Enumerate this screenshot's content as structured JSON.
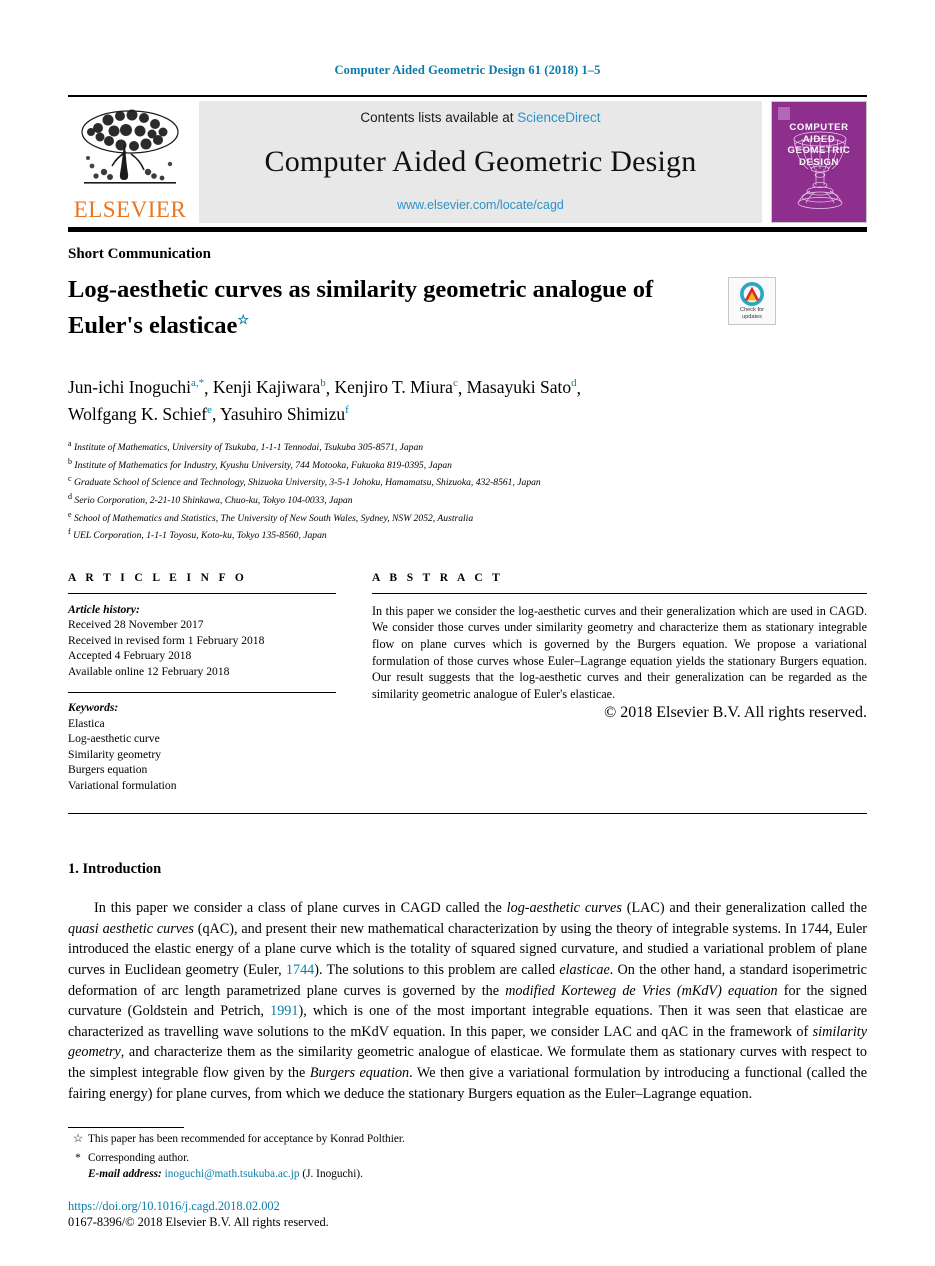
{
  "running_head": "Computer Aided Geometric Design 61 (2018) 1–5",
  "masthead": {
    "publisher_name": "ELSEVIER",
    "contents_prefix": "Contents lists available at",
    "sciencedirect": "ScienceDirect",
    "journal_title": "Computer Aided Geometric Design",
    "journal_url": "www.elsevier.com/locate/cagd",
    "cover_title": "COMPUTER\nAIDED\nGEOMETRIC\nDESIGN",
    "cover_color": "#8e2f8e",
    "link_color": "#2a93c9",
    "elsevier_orange": "#e87722"
  },
  "article": {
    "section_kind": "Short Communication",
    "title_line1": "Log-aesthetic curves as similarity geometric analogue of",
    "title_line2": "Euler's elasticae",
    "title_footnote_mark": "☆",
    "crossmark_label": "Check for\nupdates",
    "authors": [
      {
        "name": "Jun-ichi Inoguchi",
        "sup": "a,*"
      },
      {
        "name": "Kenji Kajiwara",
        "sup": "b"
      },
      {
        "name": "Kenjiro T. Miura",
        "sup": "c"
      },
      {
        "name": "Masayuki Sato",
        "sup": "d"
      },
      {
        "name": "Wolfgang K. Schief",
        "sup": "e"
      },
      {
        "name": "Yasuhiro Shimizu",
        "sup": "f"
      }
    ],
    "affiliations": [
      {
        "label": "a",
        "text": "Institute of Mathematics, University of Tsukuba, 1-1-1 Tennodai, Tsukuba 305-8571, Japan"
      },
      {
        "label": "b",
        "text": "Institute of Mathematics for Industry, Kyushu University, 744 Motooka, Fukuoka 819-0395, Japan"
      },
      {
        "label": "c",
        "text": "Graduate School of Science and Technology, Shizuoka University, 3-5-1 Johoku, Hamamatsu, Shizuoka, 432-8561, Japan"
      },
      {
        "label": "d",
        "text": "Serio Corporation, 2-21-10 Shinkawa, Chuo-ku, Tokyo 104-0033, Japan"
      },
      {
        "label": "e",
        "text": "School of Mathematics and Statistics, The University of New South Wales, Sydney, NSW 2052, Australia"
      },
      {
        "label": "f",
        "text": "UEL Corporation, 1-1-1 Toyosu, Koto-ku, Tokyo 135-8560, Japan"
      }
    ]
  },
  "info": {
    "heading": "A R T I C L E   I N F O",
    "history_label": "Article history:",
    "history": [
      "Received 28 November 2017",
      "Received in revised form 1 February 2018",
      "Accepted 4 February 2018",
      "Available online 12 February 2018"
    ],
    "keywords_label": "Keywords:",
    "keywords": [
      "Elastica",
      "Log-aesthetic curve",
      "Similarity geometry",
      "Burgers equation",
      "Variational formulation"
    ]
  },
  "abstract": {
    "heading": "A B S T R A C T",
    "body": "In this paper we consider the log-aesthetic curves and their generalization which are used in CAGD. We consider those curves under similarity geometry and characterize them as stationary integrable flow on plane curves which is governed by the Burgers equation. We propose a variational formulation of those curves whose Euler–Lagrange equation yields the stationary Burgers equation. Our result suggests that the log-aesthetic curves and their generalization can be regarded as the similarity geometric analogue of Euler's elasticae.",
    "copyright": "© 2018 Elsevier B.V. All rights reserved."
  },
  "body": {
    "section_number": "1.",
    "section_title": "Introduction",
    "paragraph_parts": [
      {
        "t": "In this paper we consider a class of plane curves in CAGD called the ",
        "s": "plain"
      },
      {
        "t": "log-aesthetic curves",
        "s": "italic"
      },
      {
        "t": " (LAC) and their generalization called the ",
        "s": "plain"
      },
      {
        "t": "quasi aesthetic curves",
        "s": "italic"
      },
      {
        "t": " (qAC), and present their new mathematical characterization by using the theory of integrable systems. In 1744, Euler introduced the elastic energy of a plane curve which is the totality of squared signed curvature, and studied a variational problem of plane curves in Euclidean geometry (Euler, ",
        "s": "plain"
      },
      {
        "t": "1744",
        "s": "link"
      },
      {
        "t": "). The solutions to this problem are called ",
        "s": "plain"
      },
      {
        "t": "elasticae",
        "s": "italic"
      },
      {
        "t": ". On the other hand, a standard isoperimetric deformation of arc length parametrized plane curves is governed by the ",
        "s": "plain"
      },
      {
        "t": "modified Korteweg de Vries (mKdV) equation",
        "s": "italic"
      },
      {
        "t": " for the signed curvature (Goldstein and Petrich, ",
        "s": "plain"
      },
      {
        "t": "1991",
        "s": "link"
      },
      {
        "t": "), which is one of the most important integrable equations. Then it was seen that elasticae are characterized as travelling wave solutions to the mKdV equation. In this paper, we consider LAC and qAC in the framework of ",
        "s": "plain"
      },
      {
        "t": "similarity geometry",
        "s": "italic"
      },
      {
        "t": ", and characterize them as the similarity geometric analogue of elasticae. We formulate them as stationary curves with respect to the simplest integrable flow given by the ",
        "s": "plain"
      },
      {
        "t": "Burgers equation",
        "s": "italic"
      },
      {
        "t": ". We then give a variational formulation by introducing a functional (called the fairing energy) for plane curves, from which we deduce the stationary Burgers equation as the Euler–Lagrange equation.",
        "s": "plain"
      }
    ]
  },
  "footnotes": [
    {
      "mark": "☆",
      "text": "This paper has been recommended for acceptance by Konrad Polthier."
    },
    {
      "mark": "*",
      "text": "Corresponding author."
    }
  ],
  "email_note": {
    "label": "E-mail address:",
    "address": "inoguchi@math.tsukuba.ac.jp",
    "owner": "(J. Inoguchi)."
  },
  "colophon": {
    "doi": "https://doi.org/10.1016/j.cagd.2018.02.002",
    "issn_line": "0167-8396/© 2018 Elsevier B.V. All rights reserved."
  }
}
